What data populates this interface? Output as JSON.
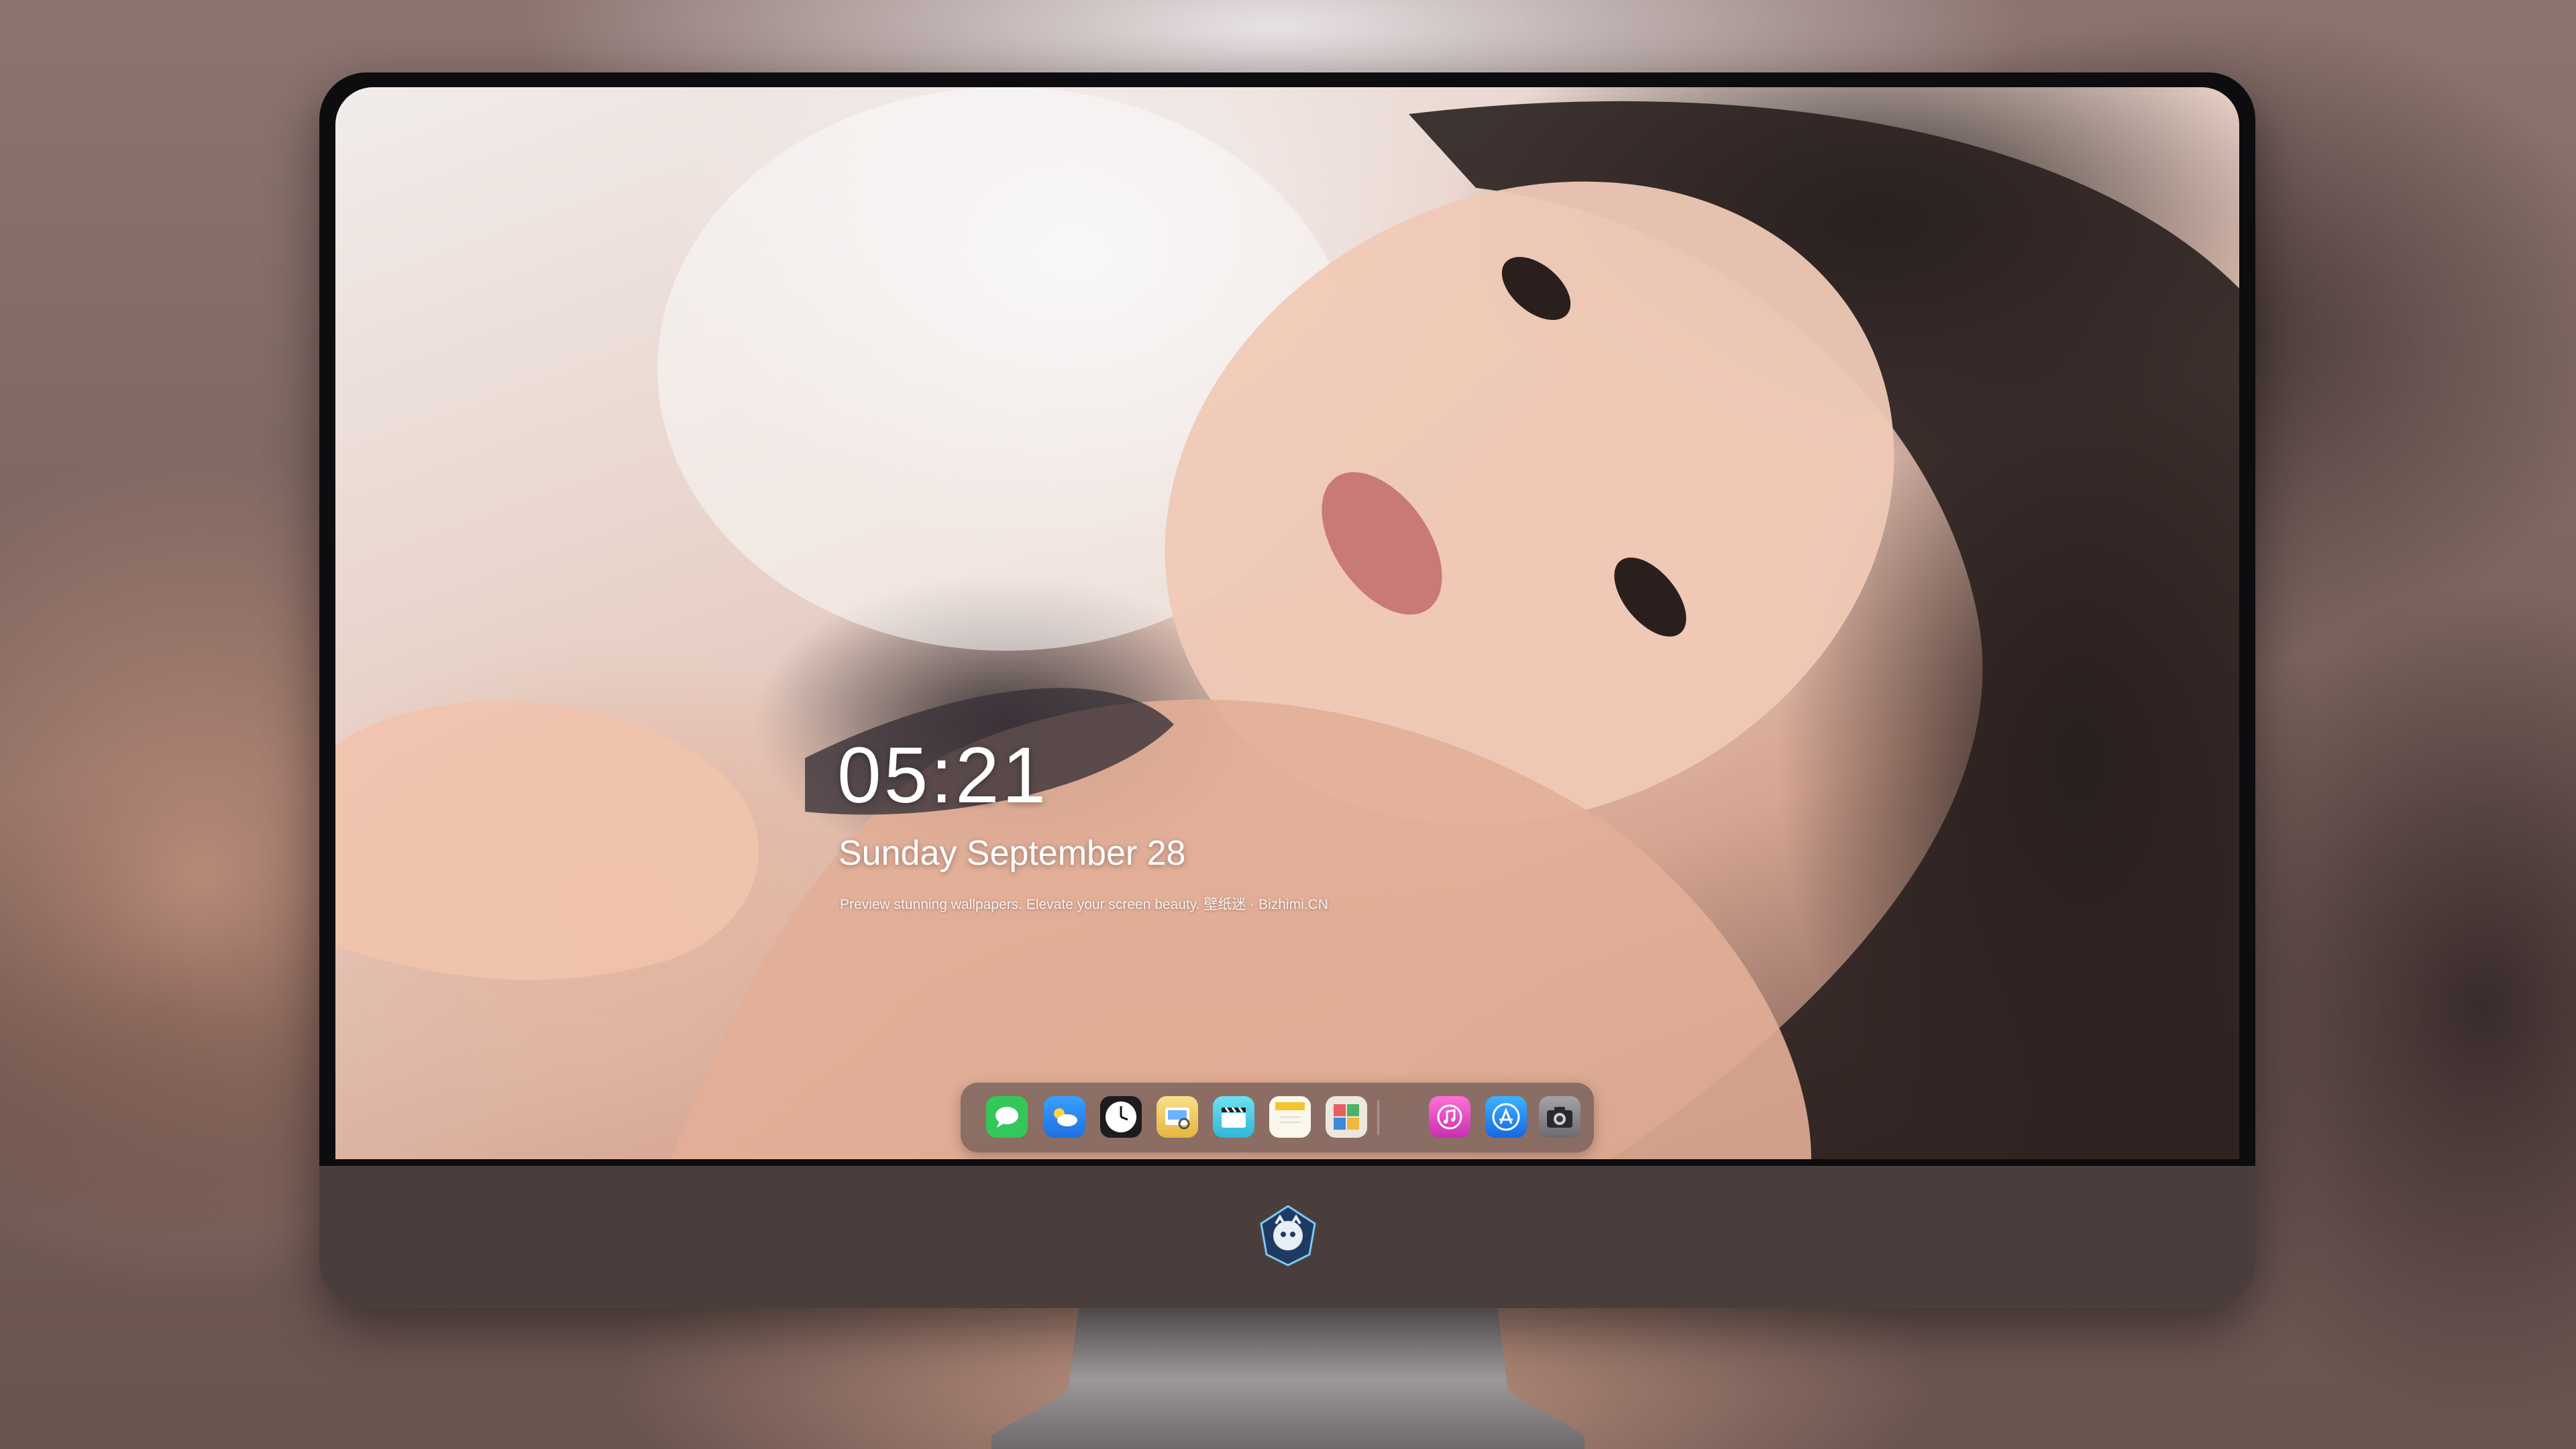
{
  "lock_screen": {
    "time": "05:21",
    "date": "Sunday September  28",
    "tagline": "Preview stunning wallpapers. Elevate your screen beauty. 壁纸迷 · Bizhimi.CN"
  },
  "dock": {
    "apps": [
      {
        "name": "messages-icon",
        "color": "#34c759"
      },
      {
        "name": "weather-icon",
        "color": "#2f8cf5"
      },
      {
        "name": "clock-icon",
        "color": "#1c1c1e"
      },
      {
        "name": "preview-icon",
        "color": "#f3d36b"
      },
      {
        "name": "clips-icon",
        "color": "#5ad1e8"
      },
      {
        "name": "notes-icon",
        "color": "#f7f2e4"
      },
      {
        "name": "photo-booth-icon",
        "color": "#e9e4dc"
      },
      {
        "name": "itunes-icon",
        "color": "#e53dbf"
      },
      {
        "name": "app-store-icon",
        "color": "#1e8bf0"
      },
      {
        "name": "camera-icon",
        "color": "#8e8e93"
      }
    ]
  },
  "colors": {
    "bezel": "#0d0d0f",
    "chin": "#4a3e3d",
    "stand": "#8a8586"
  }
}
